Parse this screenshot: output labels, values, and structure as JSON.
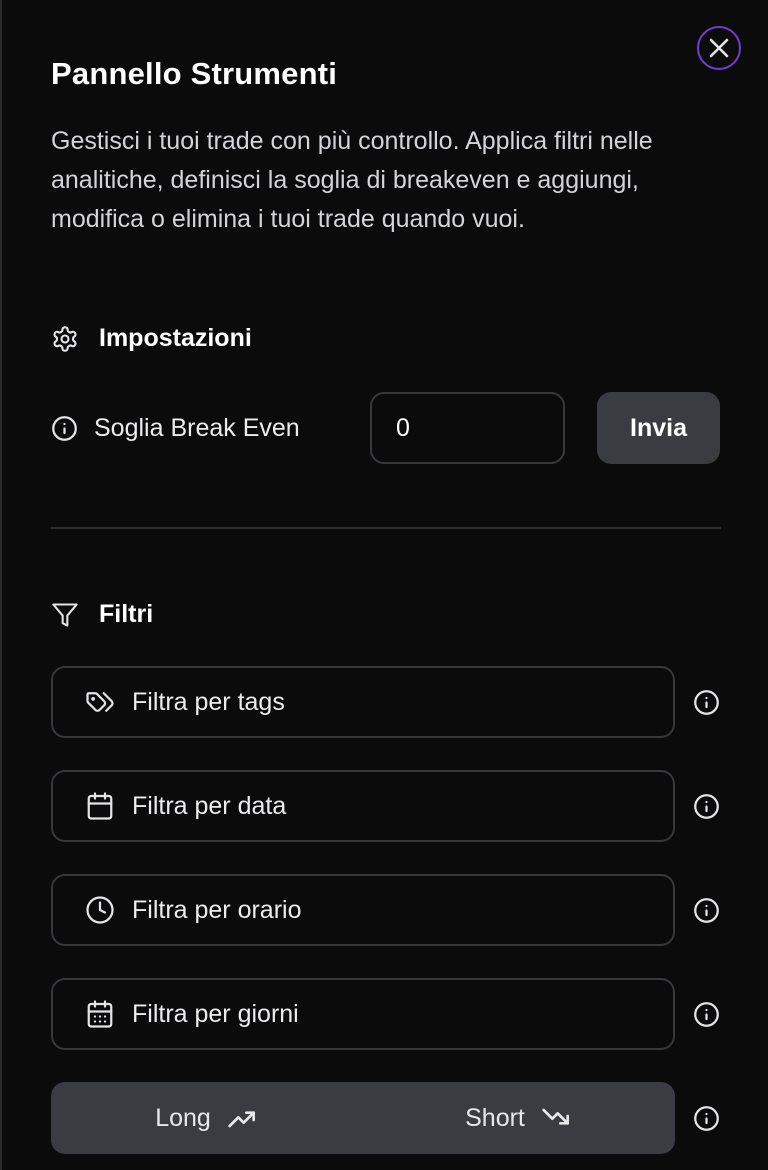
{
  "panel": {
    "title": "Pannello Strumenti",
    "description": "Gestisci i tuoi trade con più controllo. Applica filtri nelle analitiche, definisci la soglia di breakeven e aggiungi, modifica o elimina i tuoi trade quando vuoi."
  },
  "settings": {
    "heading": "Impostazioni",
    "breakeven_label": "Soglia Break Even",
    "breakeven_value": "0",
    "submit_label": "Invia"
  },
  "filters": {
    "heading": "Filtri",
    "items": [
      {
        "label": "Filtra per tags",
        "icon": "tag-icon"
      },
      {
        "label": "Filtra per data",
        "icon": "calendar-icon"
      },
      {
        "label": "Filtra per orario",
        "icon": "clock-icon"
      },
      {
        "label": "Filtra per giorni",
        "icon": "calendar-days-icon"
      }
    ],
    "direction": {
      "long_label": "Long",
      "short_label": "Short"
    }
  },
  "colors": {
    "background": "#0b0b0c",
    "close_ring": "#6d3fd0",
    "button_bg": "#3b3b42",
    "border": "#38383d"
  }
}
